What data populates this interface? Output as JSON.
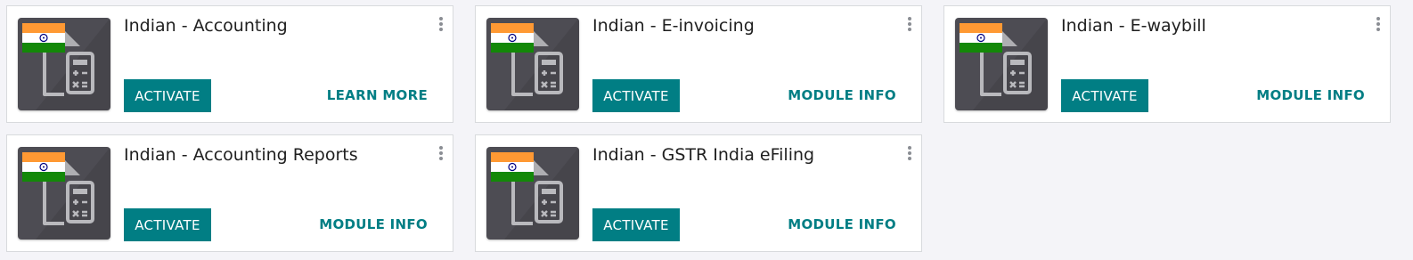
{
  "cards": [
    {
      "title": "Indian - Accounting",
      "activate_label": "ACTIVATE",
      "link_label": "LEARN MORE"
    },
    {
      "title": "Indian - E-invoicing",
      "activate_label": "ACTIVATE",
      "link_label": "MODULE INFO"
    },
    {
      "title": "Indian - E-waybill",
      "activate_label": "ACTIVATE",
      "link_label": "MODULE INFO"
    },
    {
      "title": "Indian - Accounting Reports",
      "activate_label": "ACTIVATE",
      "link_label": "MODULE INFO"
    },
    {
      "title": "Indian - GSTR India eFiling",
      "activate_label": "ACTIVATE",
      "link_label": "MODULE INFO"
    }
  ],
  "icons": {
    "module": "accounting-india-icon",
    "menu": "kebab-menu-icon"
  },
  "colors": {
    "accent": "#017e84",
    "icon_bg": "#4d4c53",
    "saffron": "#ff9933",
    "green": "#138808",
    "chakra": "#000080"
  }
}
